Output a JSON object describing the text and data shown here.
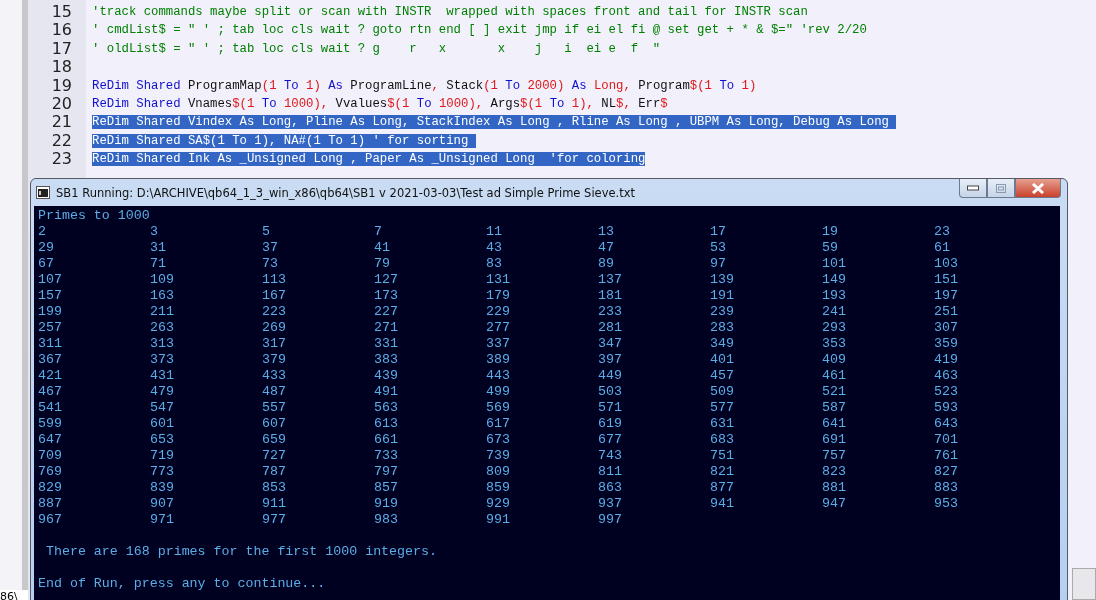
{
  "editor": {
    "lines": [
      {
        "number": "15",
        "selected": false,
        "segments": [
          {
            "kind": "comment",
            "text": "'track commands maybe split or scan with INSTR  wrapped with spaces front and tail for INSTR scan"
          }
        ]
      },
      {
        "number": "16",
        "selected": false,
        "segments": [
          {
            "kind": "comment",
            "text": "' cmdList$ = \" ' ; tab loc cls wait ? goto rtn end [ ] exit jmp if ei el fi @ set get + * & $=\" 'rev 2/20"
          }
        ]
      },
      {
        "number": "17",
        "selected": false,
        "segments": [
          {
            "kind": "comment",
            "text": "' oldList$ = \" ' ; tab loc cls wait ? g    r   x       x    j   i  ei e  f  \""
          }
        ]
      },
      {
        "number": "18"
      },
      {
        "number": "19",
        "selected": false,
        "segments": [
          {
            "kind": "keyword",
            "text": "ReDim "
          },
          {
            "kind": "keyword",
            "text": "Shared"
          },
          {
            "kind": "plain",
            "text": " ProgramMap"
          },
          {
            "kind": "symbol",
            "text": "(1 "
          },
          {
            "kind": "keyword",
            "text": "To"
          },
          {
            "kind": "symbol",
            "text": " 1) "
          },
          {
            "kind": "keyword",
            "text": "As"
          },
          {
            "kind": "plain",
            "text": " ProgramLine"
          },
          {
            "kind": "symbol",
            "text": ","
          },
          {
            "kind": "plain",
            "text": " Stack"
          },
          {
            "kind": "symbol",
            "text": "(1 "
          },
          {
            "kind": "keyword",
            "text": "To"
          },
          {
            "kind": "symbol",
            "text": " 2000) "
          },
          {
            "kind": "keyword",
            "text": "As"
          },
          {
            "kind": "symbol",
            "text": " Long,"
          },
          {
            "kind": "plain",
            "text": " Program"
          },
          {
            "kind": "symbol",
            "text": "$(1 "
          },
          {
            "kind": "keyword",
            "text": "To"
          },
          {
            "kind": "symbol",
            "text": " 1)"
          }
        ]
      },
      {
        "number": "20",
        "selected": false,
        "segments": [
          {
            "kind": "keyword",
            "text": "ReDim "
          },
          {
            "kind": "keyword",
            "text": "Shared"
          },
          {
            "kind": "plain",
            "text": " Vnames"
          },
          {
            "kind": "symbol",
            "text": "$(1 "
          },
          {
            "kind": "keyword",
            "text": "To"
          },
          {
            "kind": "symbol",
            "text": " 1000), "
          },
          {
            "kind": "plain",
            "text": "Vvalues"
          },
          {
            "kind": "symbol",
            "text": "$(1 "
          },
          {
            "kind": "keyword",
            "text": "To"
          },
          {
            "kind": "symbol",
            "text": " 1000), "
          },
          {
            "kind": "plain",
            "text": "Args"
          },
          {
            "kind": "symbol",
            "text": "$(1 "
          },
          {
            "kind": "keyword",
            "text": "To"
          },
          {
            "kind": "symbol",
            "text": " 1), "
          },
          {
            "kind": "plain",
            "text": "NL"
          },
          {
            "kind": "symbol",
            "text": "$, "
          },
          {
            "kind": "plain",
            "text": "Err"
          },
          {
            "kind": "symbol",
            "text": "$"
          }
        ]
      },
      {
        "number": "21",
        "selected": true,
        "segments": [
          {
            "kind": "plain",
            "text": "ReDim Shared Vindex As Long, Pline As Long, StackIndex As Long , Rline As Long , UBPM As Long, Debug As Long "
          }
        ]
      },
      {
        "number": "22",
        "selected": true,
        "segments": [
          {
            "kind": "plain",
            "text": "ReDim Shared SA$(1 To 1), NA#(1 To 1) ' for sorting "
          }
        ]
      },
      {
        "number": "23",
        "selected": true,
        "segments": [
          {
            "kind": "plain",
            "text": "ReDim Shared Ink As _Unsigned Long , Paper As _Unsigned Long  'for coloring"
          }
        ]
      }
    ]
  },
  "background_window": {
    "status_text": "86\\"
  },
  "console_window": {
    "title": "SB1 Running: D:\\ARCHIVE\\qb64_1_3_win_x86\\qb64\\SB1 v 2021-03-03\\Test ad Simple Prime Sieve.txt",
    "heading": "Primes to 1000",
    "primes": [
      "2",
      "3",
      "5",
      "7",
      "11",
      "13",
      "17",
      "19",
      "23",
      "29",
      "31",
      "37",
      "41",
      "43",
      "47",
      "53",
      "59",
      "61",
      "67",
      "71",
      "73",
      "79",
      "83",
      "89",
      "97",
      "101",
      "103",
      "107",
      "109",
      "113",
      "127",
      "131",
      "137",
      "139",
      "149",
      "151",
      "157",
      "163",
      "167",
      "173",
      "179",
      "181",
      "191",
      "193",
      "197",
      "199",
      "211",
      "223",
      "227",
      "229",
      "233",
      "239",
      "241",
      "251",
      "257",
      "263",
      "269",
      "271",
      "277",
      "281",
      "283",
      "293",
      "307",
      "311",
      "313",
      "317",
      "331",
      "337",
      "347",
      "349",
      "353",
      "359",
      "367",
      "373",
      "379",
      "383",
      "389",
      "397",
      "401",
      "409",
      "419",
      "421",
      "431",
      "433",
      "439",
      "443",
      "449",
      "457",
      "461",
      "463",
      "467",
      "479",
      "487",
      "491",
      "499",
      "503",
      "509",
      "521",
      "523",
      "541",
      "547",
      "557",
      "563",
      "569",
      "571",
      "577",
      "587",
      "593",
      "599",
      "601",
      "607",
      "613",
      "617",
      "619",
      "631",
      "641",
      "643",
      "647",
      "653",
      "659",
      "661",
      "673",
      "677",
      "683",
      "691",
      "701",
      "709",
      "719",
      "727",
      "733",
      "739",
      "743",
      "751",
      "757",
      "761",
      "769",
      "773",
      "787",
      "797",
      "809",
      "811",
      "821",
      "823",
      "827",
      "829",
      "839",
      "853",
      "857",
      "859",
      "863",
      "877",
      "881",
      "883",
      "887",
      "907",
      "911",
      "919",
      "929",
      "937",
      "941",
      "947",
      "953",
      "967",
      "971",
      "977",
      "983",
      "991",
      "997"
    ],
    "summary": " There are 168 primes for the first 1000 integers.",
    "prompt": "End of Run, press any to continue..."
  }
}
